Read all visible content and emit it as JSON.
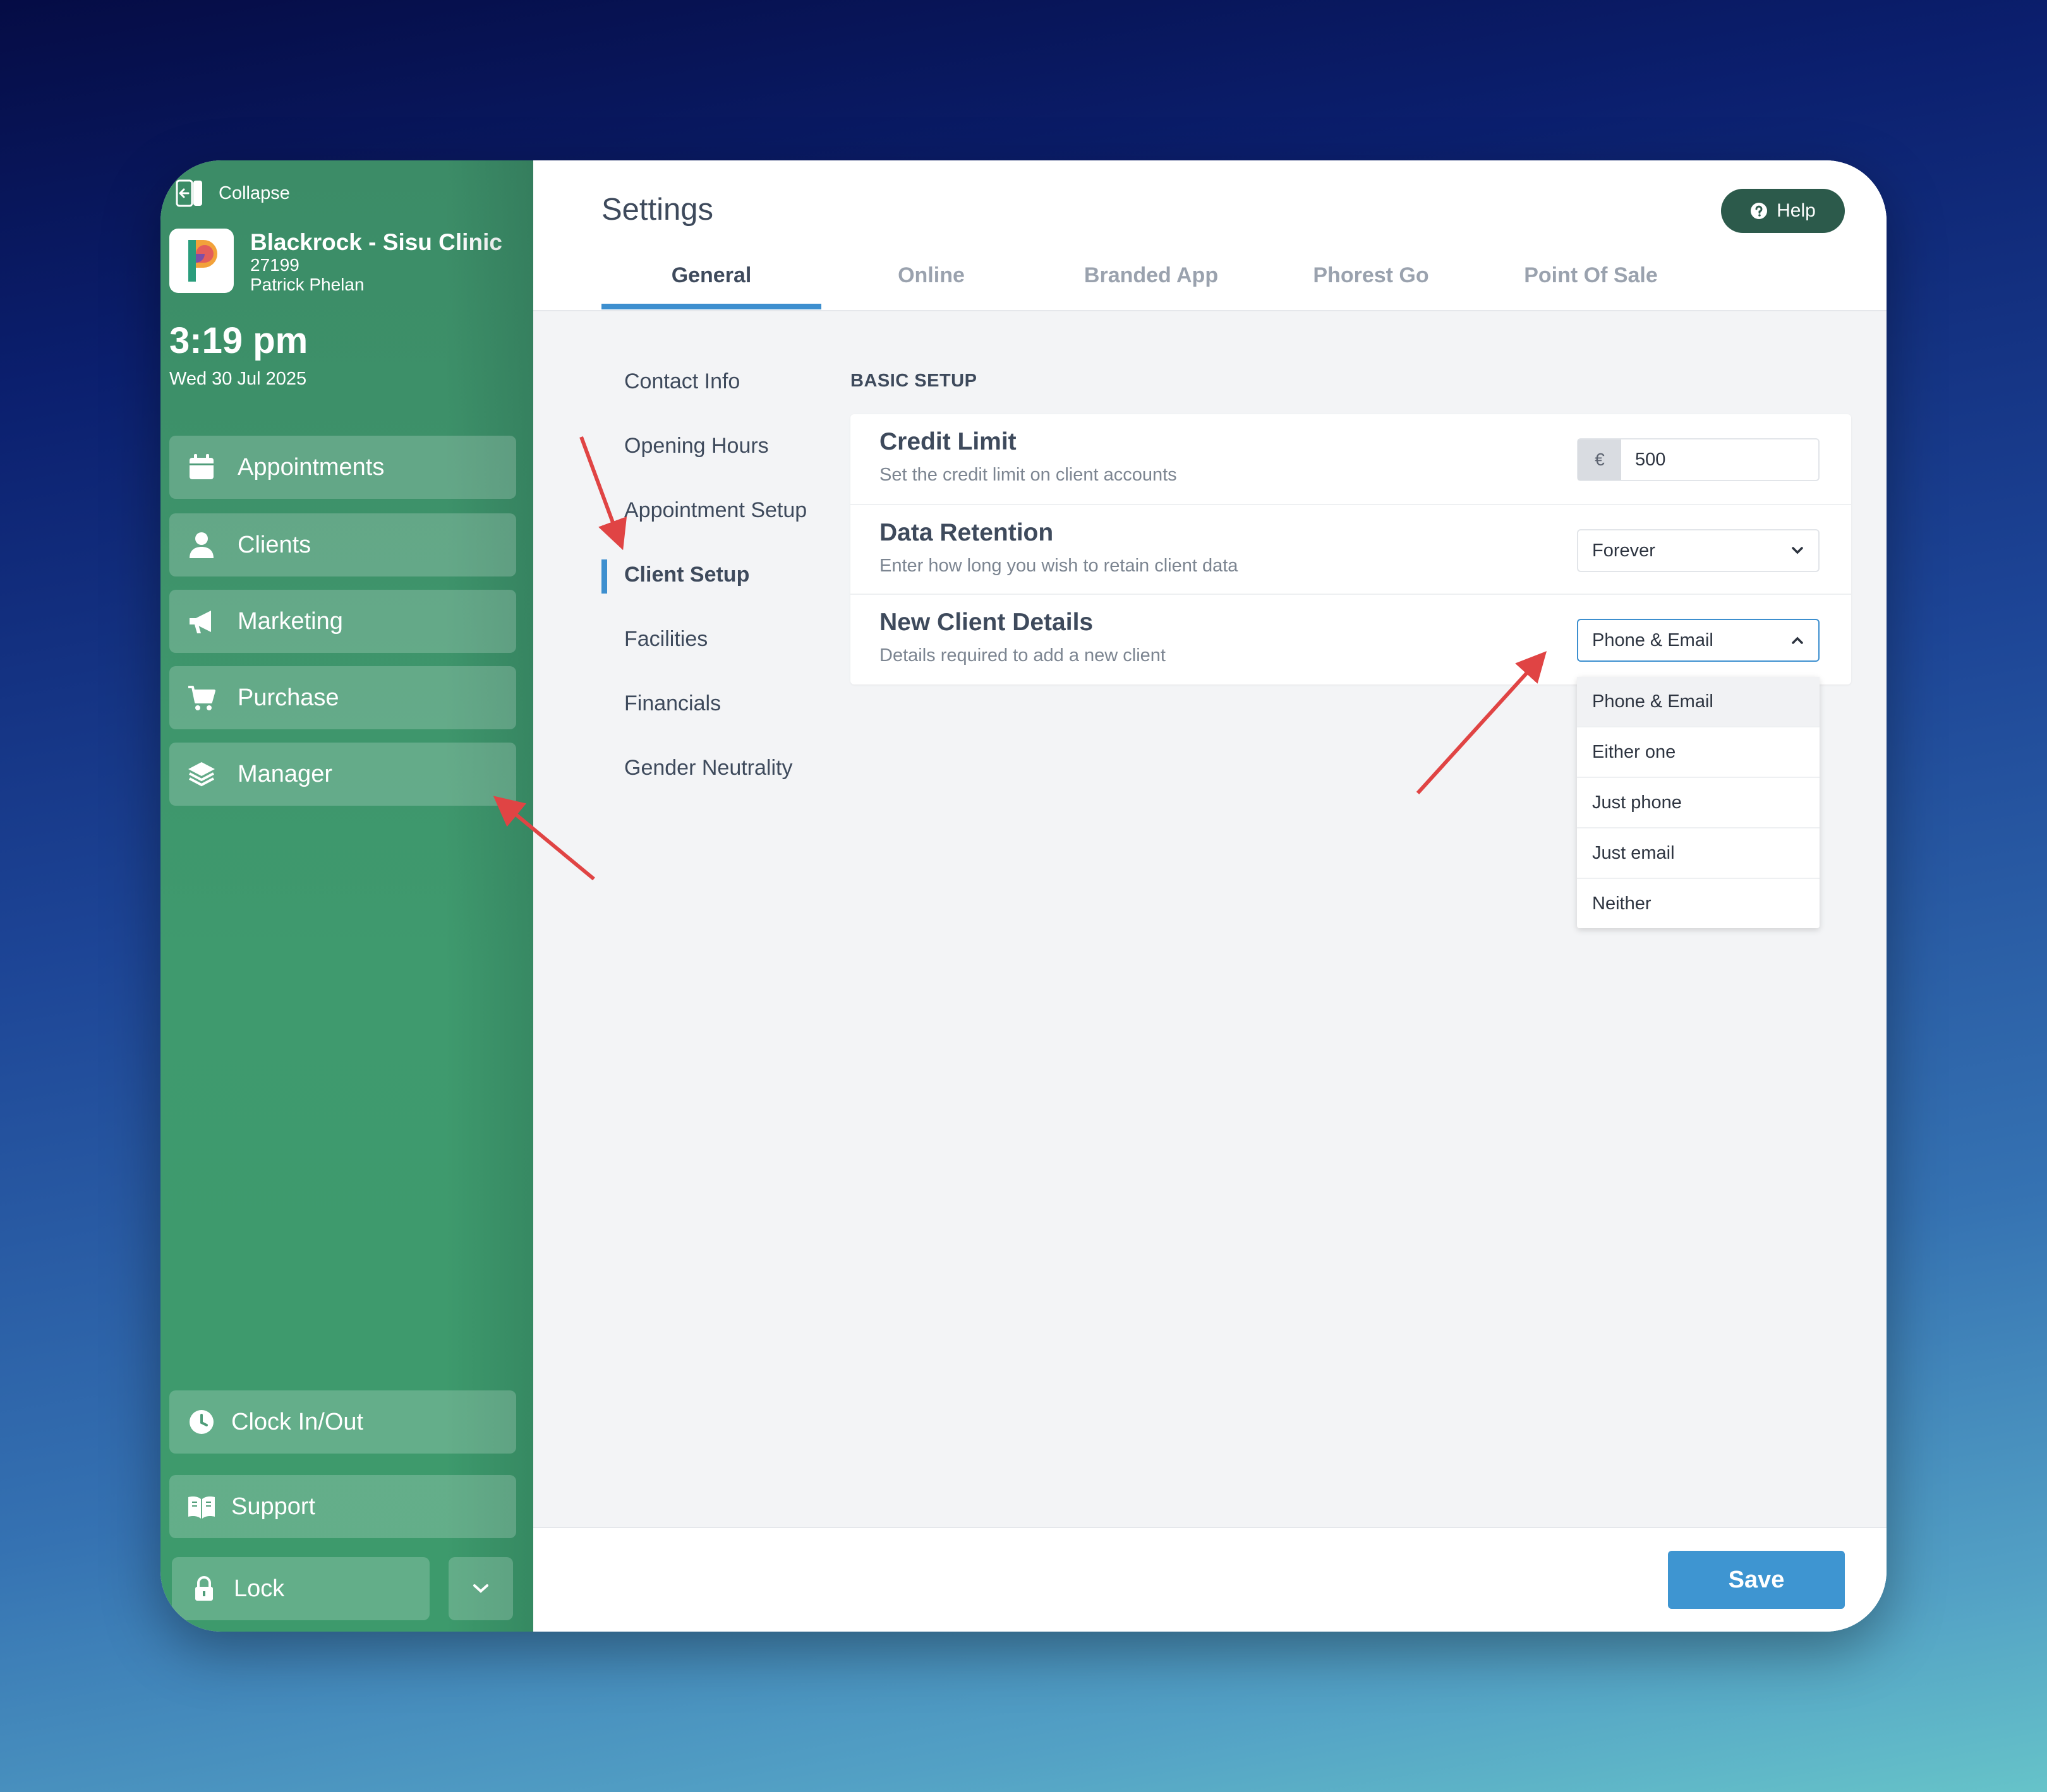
{
  "sidebar": {
    "collapse_label": "Collapse",
    "business_name": "Blackrock - Sisu Clinic",
    "business_id": "27199",
    "user_name": "Patrick Phelan",
    "time": "3:19 pm",
    "date": "Wed 30 Jul 2025",
    "nav": [
      {
        "label": "Appointments",
        "icon": "calendar-icon"
      },
      {
        "label": "Clients",
        "icon": "user-icon"
      },
      {
        "label": "Marketing",
        "icon": "megaphone-icon"
      },
      {
        "label": "Purchase",
        "icon": "cart-icon"
      },
      {
        "label": "Manager",
        "icon": "layers-icon"
      }
    ],
    "bottom": {
      "clock": "Clock In/Out",
      "support": "Support",
      "lock": "Lock"
    }
  },
  "header": {
    "title": "Settings",
    "help": "Help",
    "tabs": [
      "General",
      "Online",
      "Branded App",
      "Phorest Go",
      "Point Of Sale"
    ],
    "active_tab": "General"
  },
  "subnav": {
    "items": [
      "Contact Info",
      "Opening Hours",
      "Appointment Setup",
      "Client Setup",
      "Facilities",
      "Financials",
      "Gender Neutrality"
    ],
    "active": "Client Setup"
  },
  "basic_setup": {
    "section_label": "BASIC SETUP",
    "credit_limit": {
      "title": "Credit Limit",
      "subtitle": "Set the credit limit on client accounts",
      "currency": "€",
      "value": "500"
    },
    "data_retention": {
      "title": "Data Retention",
      "subtitle": "Enter how long you wish to retain client data",
      "value": "Forever"
    },
    "new_client_details": {
      "title": "New Client Details",
      "subtitle": "Details required to add a new client",
      "value": "Phone & Email",
      "options": [
        "Phone & Email",
        "Either one",
        "Just phone",
        "Just email",
        "Neither"
      ]
    }
  },
  "footer": {
    "save": "Save"
  },
  "colors": {
    "sidebar_green": "#3f9a6e",
    "accent_blue": "#3e95d1",
    "help_dark_green": "#2c5a4b",
    "annotation_red": "#e04444"
  }
}
